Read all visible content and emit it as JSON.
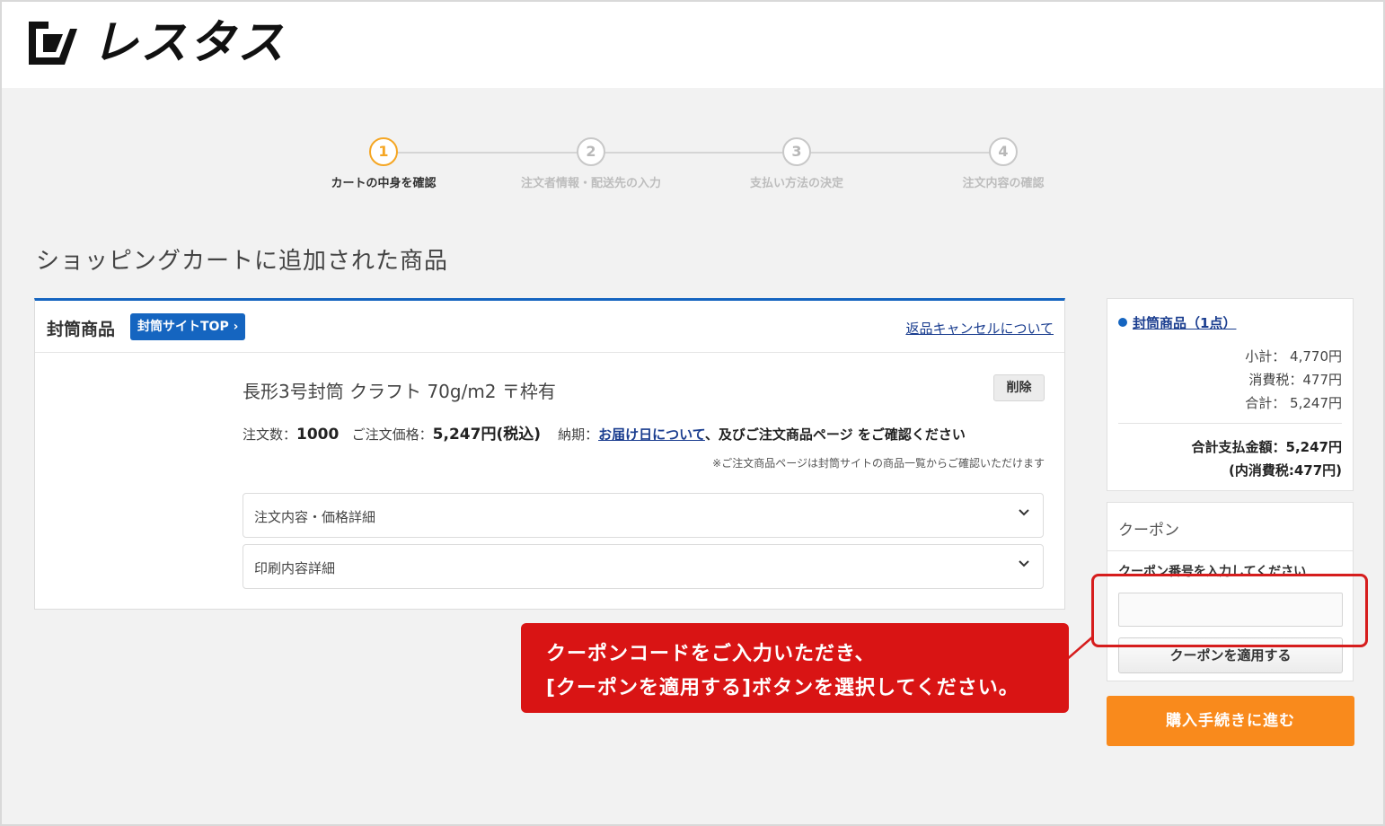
{
  "brand": {
    "name": "レスタス"
  },
  "steps": [
    {
      "num": "1",
      "label": "カートの中身を確認",
      "active": true
    },
    {
      "num": "2",
      "label": "注文者情報・配送先の入力",
      "active": false
    },
    {
      "num": "3",
      "label": "支払い方法の決定",
      "active": false
    },
    {
      "num": "4",
      "label": "注文内容の確認",
      "active": false
    }
  ],
  "page_title": "ショッピングカートに追加された商品",
  "cart": {
    "category": "封筒商品",
    "site_top_button": "封筒サイトTOP",
    "return_link": "返品キャンセルについて",
    "product": {
      "name": "長形3号封筒 クラフト 70g/m2 〒枠有",
      "delete_label": "削除",
      "qty_label": "注文数：",
      "qty": "1000",
      "price_label": "ご注文価格：",
      "price": "5,247円(税込)",
      "delivery_label": "納期：",
      "delivery_link": "お届け日について",
      "delivery_tail": "、及びご注文商品ページ をご確認ください",
      "note": "※ご注文商品ページは封筒サイトの商品一覧からご確認いただけます"
    },
    "accordions": [
      {
        "label": "注文内容・価格詳細"
      },
      {
        "label": "印刷内容詳細"
      }
    ]
  },
  "summary": {
    "title": "封筒商品（1点）",
    "subtotal": "小計：  4,770円",
    "tax": "消費税：477円",
    "total": "合計：  5,247円",
    "grand_total": "合計支払金額：5,247円",
    "grand_tax": "(内消費税:477円)"
  },
  "coupon": {
    "title": "クーポン",
    "hint": "クーポン番号を入力してください",
    "input_value": "",
    "apply_button": "クーポンを適用する"
  },
  "proceed_button": "購入手続きに進む",
  "callout": {
    "line1": "クーポンコードをご入力いただき、",
    "line2": "[クーポンを適用する]ボタンを選択してください。"
  },
  "colors": {
    "accent_blue": "#1565c0",
    "orange": "#f98a1c",
    "step_active": "#f5a623",
    "callout_red": "#d91414"
  }
}
